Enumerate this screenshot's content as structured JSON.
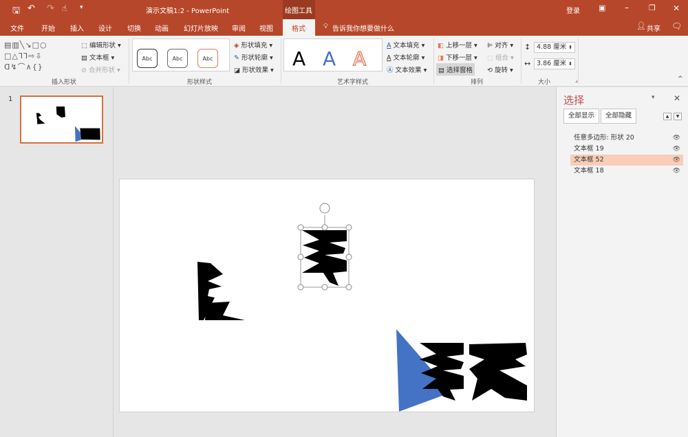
{
  "titlebar": {
    "title": "演示文稿1:2 - PowerPoint",
    "context_tab": "绘图工具",
    "login": "登录"
  },
  "tabs": [
    "文件",
    "开始",
    "插入",
    "设计",
    "切换",
    "动画",
    "幻灯片放映",
    "审阅",
    "视图",
    "格式"
  ],
  "tell_me": "告诉我你想要做什么",
  "share": "共享",
  "ribbon": {
    "insert_shapes": {
      "label": "插入形状",
      "edit_shape": "编辑形状",
      "text_box": "文本框",
      "merge_shapes": "合并形状"
    },
    "shape_styles": {
      "label": "形状样式",
      "sample": "Abc",
      "fill": "形状填充",
      "outline": "形状轮廓",
      "effects": "形状效果"
    },
    "wordart": {
      "label": "艺术字样式",
      "sample": "A",
      "text_fill": "文本填充",
      "text_outline": "文本轮廓",
      "text_effects": "文本效果"
    },
    "arrange": {
      "label": "排列",
      "bring_forward": "上移一层",
      "send_backward": "下移一层",
      "selection_pane": "选择窗格",
      "align": "对齐",
      "group": "组合",
      "rotate": "旋转"
    },
    "size": {
      "label": "大小",
      "height": "4.88 厘米",
      "width": "3.86 厘米"
    }
  },
  "thumbnail": {
    "number": "1"
  },
  "selection_pane": {
    "title": "选择",
    "show_all": "全部显示",
    "hide_all": "全部隐藏",
    "items": [
      {
        "label": "任意多边形: 形状 20"
      },
      {
        "label": "文本框 19"
      },
      {
        "label": "文本框 52",
        "selected": true
      },
      {
        "label": "文本框 18"
      }
    ]
  },
  "colors": {
    "accent": "#b7472a",
    "selected_row": "#f9cdb8",
    "shape_blue": "#4472c4"
  }
}
